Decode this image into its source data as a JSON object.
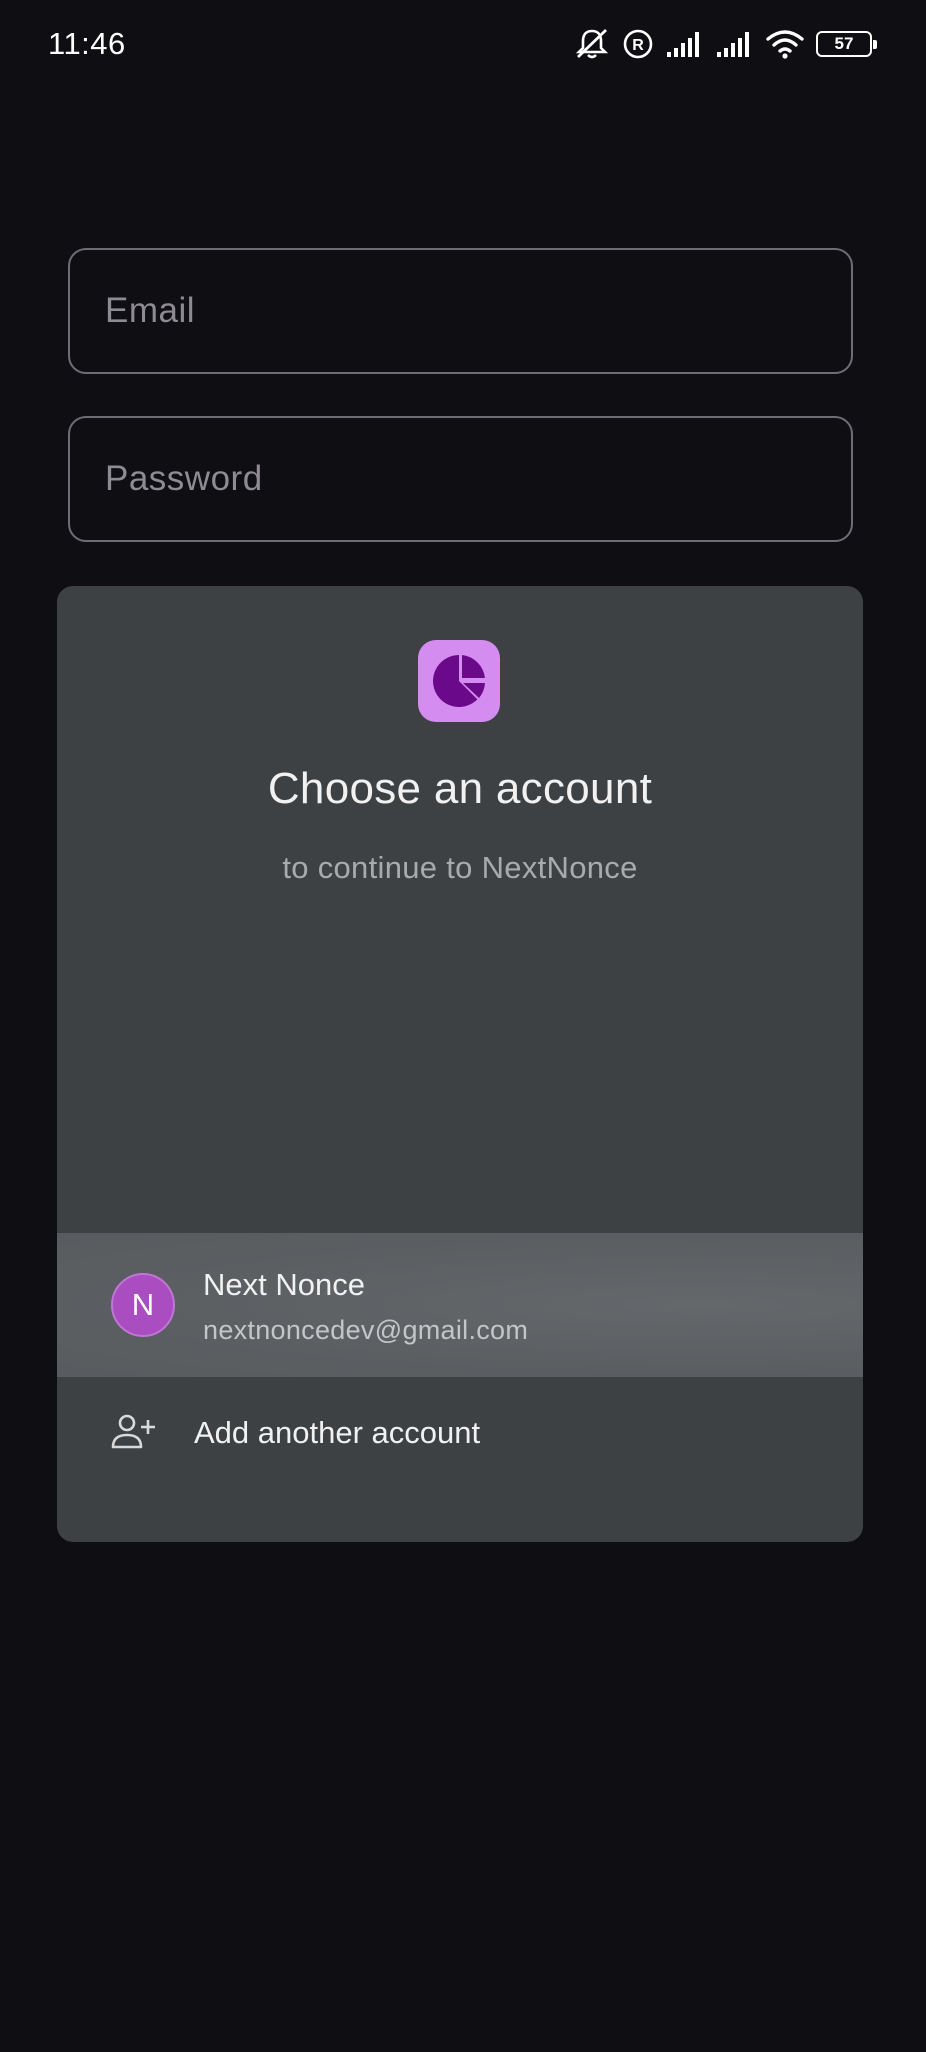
{
  "status_bar": {
    "time": "11:46",
    "battery": "57",
    "icons": [
      "bell-off-icon",
      "registered-icon",
      "signal-icon",
      "signal-icon",
      "wifi-icon",
      "battery-icon"
    ]
  },
  "form": {
    "email_placeholder": "Email",
    "password_placeholder": "Password"
  },
  "chooser": {
    "logo_icon": "pie-chart-icon",
    "title": "Choose an account",
    "subtitle": "to continue to NextNonce",
    "accounts": [
      {
        "initial": "N",
        "name": "Next Nonce",
        "email": "nextnoncedev@gmail.com"
      }
    ],
    "add_account_label": "Add another account",
    "add_account_icon": "person-add-icon"
  },
  "colors": {
    "background": "#0f0e12",
    "card": "#3d4144",
    "selected_row": "#5b5f62",
    "accent": "#d58cf0",
    "avatar": "#a94dc0"
  }
}
